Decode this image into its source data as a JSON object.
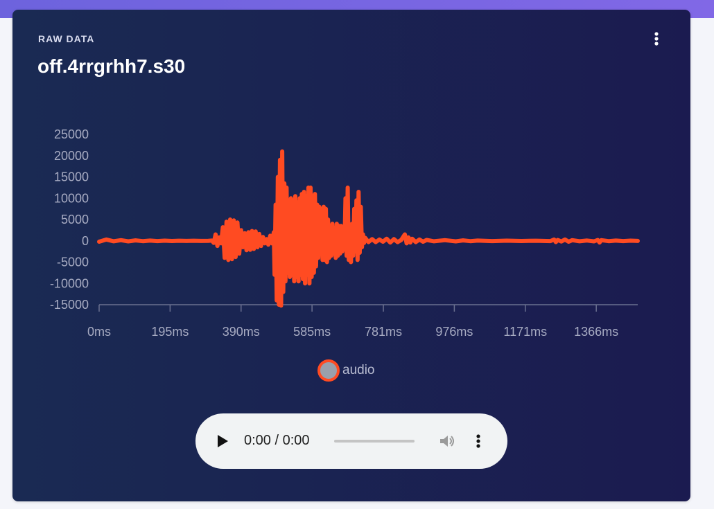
{
  "card": {
    "section_label": "RAW DATA",
    "title": "off.4rrgrhh7.s30",
    "menu_icon": "more-vertical-icon"
  },
  "chart_data": {
    "type": "line",
    "series": [
      {
        "name": "audio",
        "color": "#ff4b22",
        "points": [
          [
            0,
            -200
          ],
          [
            20,
            300
          ],
          [
            40,
            -100
          ],
          [
            60,
            150
          ],
          [
            80,
            -120
          ],
          [
            100,
            100
          ],
          [
            120,
            -80
          ],
          [
            140,
            60
          ],
          [
            160,
            -50
          ],
          [
            180,
            40
          ],
          [
            200,
            -40
          ],
          [
            220,
            30
          ],
          [
            240,
            -30
          ],
          [
            260,
            20
          ],
          [
            280,
            -20
          ],
          [
            300,
            -10
          ],
          [
            310,
            50
          ],
          [
            315,
            -500
          ],
          [
            320,
            1500
          ],
          [
            325,
            -1200
          ],
          [
            330,
            800
          ],
          [
            335,
            -600
          ],
          [
            340,
            3200
          ],
          [
            345,
            -4000
          ],
          [
            350,
            4500
          ],
          [
            355,
            -4500
          ],
          [
            360,
            5000
          ],
          [
            365,
            -4300
          ],
          [
            370,
            4800
          ],
          [
            375,
            -3800
          ],
          [
            380,
            4300
          ],
          [
            385,
            -3000
          ],
          [
            390,
            2500
          ],
          [
            395,
            -1500
          ],
          [
            400,
            1800
          ],
          [
            405,
            -2200
          ],
          [
            410,
            2000
          ],
          [
            415,
            -2100
          ],
          [
            420,
            2300
          ],
          [
            425,
            -1900
          ],
          [
            430,
            2200
          ],
          [
            435,
            -1500
          ],
          [
            440,
            1600
          ],
          [
            445,
            -1200
          ],
          [
            450,
            900
          ],
          [
            455,
            -600
          ],
          [
            460,
            400
          ],
          [
            465,
            -900
          ],
          [
            470,
            1200
          ],
          [
            475,
            -600
          ],
          [
            480,
            2000
          ],
          [
            482,
            -8000
          ],
          [
            485,
            8500
          ],
          [
            488,
            -14000
          ],
          [
            491,
            15000
          ],
          [
            494,
            -15000
          ],
          [
            497,
            19000
          ],
          [
            500,
            -15200
          ],
          [
            503,
            21000
          ],
          [
            506,
            -12000
          ],
          [
            509,
            13500
          ],
          [
            512,
            -9500
          ],
          [
            515,
            12500
          ],
          [
            518,
            -7500
          ],
          [
            521,
            9500
          ],
          [
            524,
            -8500
          ],
          [
            527,
            10000
          ],
          [
            530,
            -8000
          ],
          [
            533,
            9500
          ],
          [
            536,
            -9500
          ],
          [
            539,
            10500
          ],
          [
            542,
            -8500
          ],
          [
            545,
            9000
          ],
          [
            548,
            -9500
          ],
          [
            551,
            10000
          ],
          [
            554,
            -8000
          ],
          [
            557,
            11000
          ],
          [
            560,
            -9000
          ],
          [
            563,
            11500
          ],
          [
            566,
            -10000
          ],
          [
            569,
            10500
          ],
          [
            572,
            -8000
          ],
          [
            575,
            12500
          ],
          [
            578,
            -10000
          ],
          [
            581,
            12500
          ],
          [
            584,
            -8500
          ],
          [
            587,
            10500
          ],
          [
            590,
            -7500
          ],
          [
            593,
            11000
          ],
          [
            596,
            -6000
          ],
          [
            599,
            8500
          ],
          [
            602,
            -4000
          ],
          [
            605,
            8000
          ],
          [
            608,
            -3000
          ],
          [
            611,
            7500
          ],
          [
            614,
            -4500
          ],
          [
            617,
            8000
          ],
          [
            620,
            -4500
          ],
          [
            623,
            7500
          ],
          [
            626,
            -5000
          ],
          [
            629,
            5000
          ],
          [
            632,
            -4000
          ],
          [
            635,
            3500
          ],
          [
            638,
            -3500
          ],
          [
            641,
            4000
          ],
          [
            644,
            -3000
          ],
          [
            647,
            3000
          ],
          [
            650,
            -4000
          ],
          [
            653,
            4000
          ],
          [
            656,
            -3500
          ],
          [
            659,
            3500
          ],
          [
            662,
            -3000
          ],
          [
            665,
            3500
          ],
          [
            668,
            -2500
          ],
          [
            671,
            3000
          ],
          [
            674,
            -2000
          ],
          [
            677,
            10000
          ],
          [
            680,
            -3500
          ],
          [
            683,
            12500
          ],
          [
            686,
            -4500
          ],
          [
            689,
            3500
          ],
          [
            692,
            -5000
          ],
          [
            695,
            4000
          ],
          [
            698,
            -3500
          ],
          [
            701,
            7500
          ],
          [
            704,
            -2500
          ],
          [
            707,
            9500
          ],
          [
            710,
            -4500
          ],
          [
            713,
            11500
          ],
          [
            716,
            -2800
          ],
          [
            719,
            8000
          ],
          [
            722,
            -1500
          ],
          [
            725,
            1500
          ],
          [
            728,
            -500
          ],
          [
            731,
            700
          ],
          [
            740,
            -300
          ],
          [
            750,
            400
          ],
          [
            760,
            -300
          ],
          [
            770,
            300
          ],
          [
            780,
            -200
          ],
          [
            790,
            500
          ],
          [
            800,
            -400
          ],
          [
            810,
            400
          ],
          [
            820,
            -300
          ],
          [
            830,
            200
          ],
          [
            840,
            1500
          ],
          [
            845,
            -600
          ],
          [
            850,
            800
          ],
          [
            855,
            -400
          ],
          [
            860,
            500
          ],
          [
            870,
            -300
          ],
          [
            880,
            300
          ],
          [
            890,
            -200
          ],
          [
            900,
            200
          ],
          [
            920,
            -100
          ],
          [
            950,
            150
          ],
          [
            980,
            -120
          ],
          [
            1000,
            100
          ],
          [
            1020,
            -80
          ],
          [
            1040,
            60
          ],
          [
            1080,
            -50
          ],
          [
            1120,
            40
          ],
          [
            1160,
            -40
          ],
          [
            1200,
            30
          ],
          [
            1240,
            -60
          ],
          [
            1250,
            300
          ],
          [
            1255,
            -300
          ],
          [
            1260,
            200
          ],
          [
            1270,
            -150
          ],
          [
            1280,
            300
          ],
          [
            1290,
            -200
          ],
          [
            1300,
            150
          ],
          [
            1320,
            -100
          ],
          [
            1340,
            80
          ],
          [
            1360,
            -120
          ],
          [
            1370,
            200
          ],
          [
            1375,
            -400
          ],
          [
            1380,
            150
          ],
          [
            1400,
            -80
          ],
          [
            1420,
            60
          ],
          [
            1440,
            -50
          ],
          [
            1460,
            40
          ],
          [
            1480,
            -30
          ]
        ]
      }
    ],
    "x_tick_labels": [
      "0ms",
      "195ms",
      "390ms",
      "585ms",
      "781ms",
      "976ms",
      "1171ms",
      "1366ms"
    ],
    "x_tick_values": [
      0,
      195,
      390,
      585,
      781,
      976,
      1171,
      1366
    ],
    "y_tick_labels": [
      "25000",
      "20000",
      "15000",
      "10000",
      "5000",
      "0",
      "-5000",
      "-10000",
      "-15000"
    ],
    "y_tick_values": [
      25000,
      20000,
      15000,
      10000,
      5000,
      0,
      -5000,
      -10000,
      -15000
    ],
    "xlim": [
      0,
      1480
    ],
    "ylim": [
      -15000,
      25000
    ],
    "grid": false,
    "legend": "bottom-center"
  },
  "legend": {
    "label": "audio"
  },
  "player": {
    "time": "0:00 / 0:00",
    "play_icon": "play-icon",
    "volume_icon": "volume-icon",
    "menu_icon": "more-vertical-icon",
    "progress_fraction": 0
  }
}
